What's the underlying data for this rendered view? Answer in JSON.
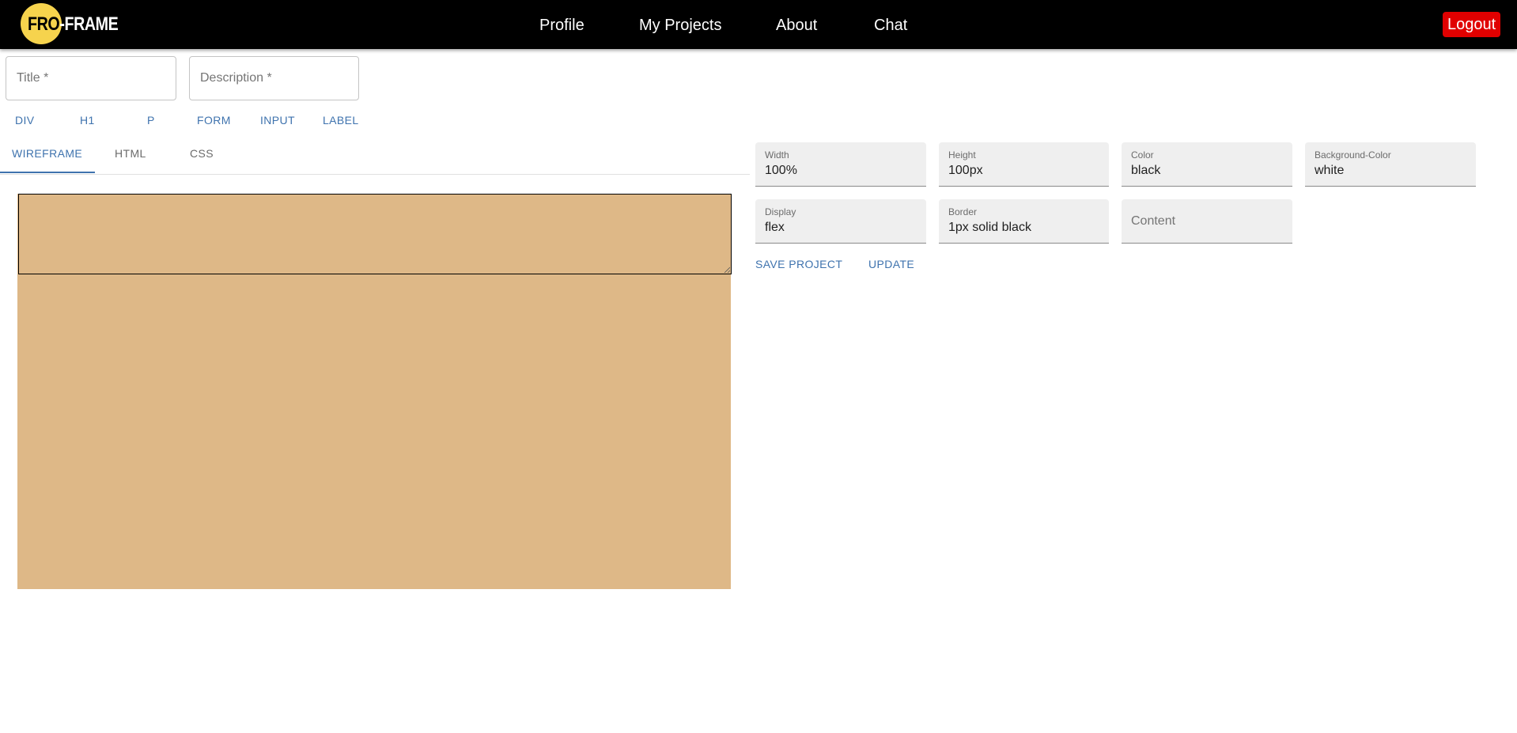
{
  "navbar": {
    "logo": {
      "part1": "FRO",
      "part2": "-FRAME",
      "circle_color": "#f6d34d"
    },
    "links": [
      "Profile",
      "My Projects",
      "About",
      "Chat"
    ],
    "logout_label": "Logout",
    "logout_color": "#e00000"
  },
  "project_form": {
    "title_placeholder": "Title *",
    "description_placeholder": "Description *"
  },
  "element_buttons": [
    "DIV",
    "H1",
    "P",
    "FORM",
    "INPUT",
    "LABEL"
  ],
  "tabs": {
    "items": [
      "WIREFRAME",
      "HTML",
      "CSS"
    ],
    "active": "WIREFRAME"
  },
  "canvas": {
    "background_color": "#deb887",
    "element_border_color": "#000000"
  },
  "style_fields": {
    "width": {
      "label": "Width",
      "value": "100%"
    },
    "height": {
      "label": "Height",
      "value": "100px"
    },
    "color": {
      "label": "Color",
      "value": "black"
    },
    "background_color": {
      "label": "Background-Color",
      "value": "white"
    },
    "display": {
      "label": "Display",
      "value": "flex"
    },
    "border": {
      "label": "Border",
      "value": "1px solid black"
    },
    "content": {
      "placeholder": "Content"
    }
  },
  "actions": {
    "save_label": "SAVE PROJECT",
    "update_label": "UPDATE"
  },
  "accent_color": "#3f73ae"
}
